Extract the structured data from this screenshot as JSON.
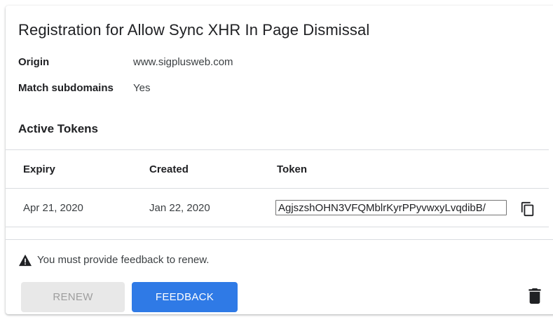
{
  "dialog": {
    "title": "Registration for Allow Sync XHR In Page Dismissal",
    "origin_label": "Origin",
    "origin_value": "www.sigplusweb.com",
    "subdomains_label": "Match subdomains",
    "subdomains_value": "Yes"
  },
  "tokens": {
    "section_title": "Active Tokens",
    "columns": [
      "Expiry",
      "Created",
      "Token"
    ],
    "rows": [
      {
        "expiry": "Apr 21, 2020",
        "created": "Jan 22, 2020",
        "token": "AgjszshOHN3VFQMblrKyrPPyvwxyLvqdibB/"
      }
    ],
    "copy_icon": "content-copy-icon"
  },
  "footer": {
    "warning_icon": "warning-icon",
    "warning_text": "You must provide feedback to renew.",
    "renew_label": "Renew",
    "feedback_label": "Feedback",
    "delete_icon": "trash-icon"
  },
  "colors": {
    "accent": "#2f7ae6",
    "disabled_bg": "#e8e8e8",
    "divider": "#dadce0"
  }
}
